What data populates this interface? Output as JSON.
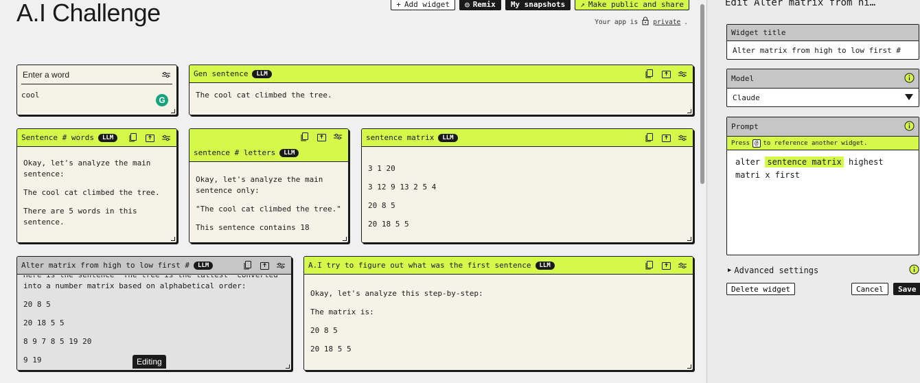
{
  "app": {
    "title": "A.I Challenge"
  },
  "top_actions": {
    "add_widget": "Add widget",
    "remix": "Remix",
    "snapshots": "My snapshots",
    "share": "Make public and share"
  },
  "privacy": {
    "prefix": "Your app is",
    "status": "private",
    "suffix": "."
  },
  "widgets": {
    "enter_word": {
      "title": "Enter a word",
      "value": "cool"
    },
    "gen_sentence": {
      "title": "Gen sentence",
      "badge": "LLM",
      "output": "The cool cat climbed the tree."
    },
    "sentence_words": {
      "title": "Sentence # words",
      "badge": "LLM",
      "lines": [
        "Okay, let's analyze the main sentence:",
        "The cool cat climbed the tree.",
        "There are 5 words in this sentence."
      ]
    },
    "sentence_letters": {
      "title": "sentence # letters",
      "badge": "LLM",
      "lines": [
        "Okay, let's analyze the main sentence only:",
        "\"The cool cat climbed the tree.\"",
        "This sentence contains 18"
      ]
    },
    "sentence_matrix": {
      "title": "sentence matrix",
      "badge": "LLM",
      "lines": [
        "3 1 20",
        "3 12 9 13 2 5 4",
        "20 8 5",
        "20 18 5 5"
      ]
    },
    "alter_matrix": {
      "title": "Alter matrix from high to low first #",
      "badge": "LLM",
      "partial_top": "Here is the sentence \"The tree is the tallest\" converted",
      "lines": [
        "into a number matrix based on alphabetical order:",
        "20 8 5",
        "20 18 5 5",
        "8 9 7 8 5 19 20"
      ],
      "partial_bottom": "9 19",
      "editing_label": "Editing"
    },
    "guess_sentence": {
      "title": "A.I try to figure out what was the first sentence",
      "badge": "LLM",
      "lines": [
        "Okay, let's analyze this step-by-step:",
        "The matrix is:",
        "20 8 5",
        "20 18 5 5"
      ]
    }
  },
  "panel": {
    "title": "Edit Alter matrix from hi…",
    "widget_title_label": "Widget title",
    "widget_title_value": "Alter matrix from high to low first #",
    "model_label": "Model",
    "model_value": "Claude",
    "prompt_label": "Prompt",
    "hint_press": "Press",
    "hint_key": "@",
    "hint_rest": "to reference another widget.",
    "prompt_before": "alter",
    "prompt_chip": "sentence matrix",
    "prompt_after": "highest matri x first",
    "advanced": "Advanced settings",
    "delete": "Delete widget",
    "cancel": "Cancel",
    "save": "Save"
  },
  "colors": {
    "accent": "#d4f94a",
    "dark": "#1a1a1a",
    "card": "#f5f3e8",
    "editing_card": "#e2e2e2"
  }
}
